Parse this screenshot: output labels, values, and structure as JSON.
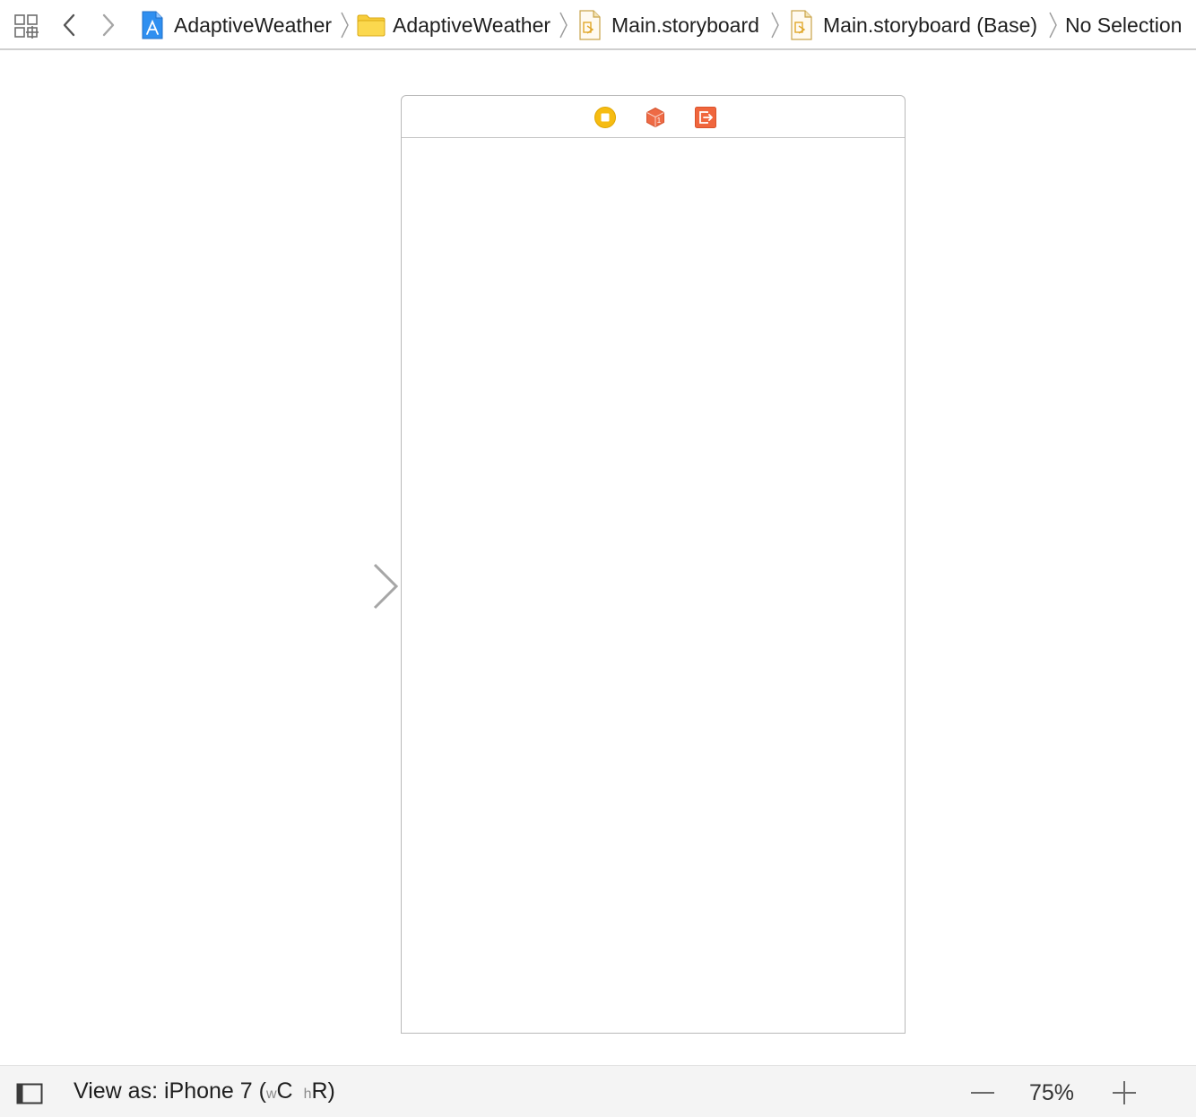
{
  "jumpbar": {
    "crumbs": [
      {
        "label": "AdaptiveWeather",
        "icon": "xcode-project-icon"
      },
      {
        "label": "AdaptiveWeather",
        "icon": "folder-icon"
      },
      {
        "label": "Main.storyboard",
        "icon": "storyboard-file-icon"
      },
      {
        "label": "Main.storyboard (Base)",
        "icon": "storyboard-file-icon"
      },
      {
        "label": "No Selection"
      }
    ]
  },
  "scene": {
    "dock_icons": [
      "view-controller-icon",
      "first-responder-icon",
      "exit-icon"
    ],
    "colors": {
      "view_controller": "#F5B800",
      "first_responder": "#EE6A45",
      "exit": "#F0663D"
    }
  },
  "bottombar": {
    "view_as_prefix": "View as: iPhone 7 (",
    "w_label": "w",
    "w_value": "C",
    "h_label": "h",
    "h_value": "R",
    "suffix": ")",
    "zoom": "75%"
  }
}
